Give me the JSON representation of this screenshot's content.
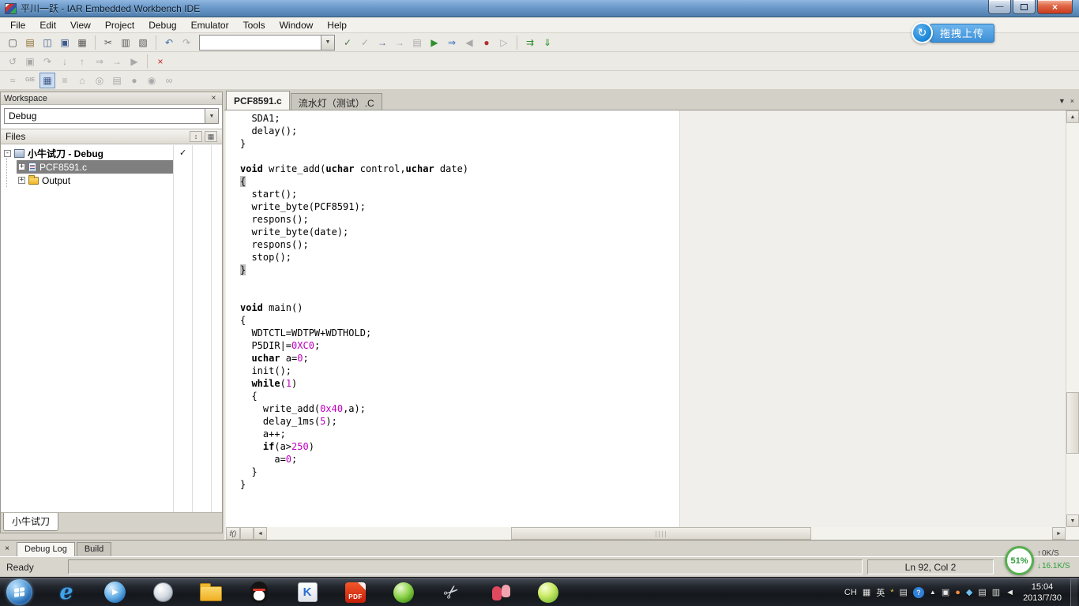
{
  "window": {
    "title": "平川一跃 - IAR Embedded Workbench IDE"
  },
  "overlay": {
    "label": "拖拽上传",
    "icon_glyph": "↻"
  },
  "glyphs": {
    "close": "×",
    "dropdown": "▼",
    "up": "▲",
    "down": "▼",
    "left": "◄",
    "right": "►",
    "fn": "f()",
    "min": "—"
  },
  "menubar": {
    "items": [
      "File",
      "Edit",
      "View",
      "Project",
      "Debug",
      "Emulator",
      "Tools",
      "Window",
      "Help"
    ]
  },
  "toolbar_main": {
    "icons": [
      {
        "type": "icon",
        "name": "new-document-icon",
        "glyph": "▢",
        "color": "#4a4a4a"
      },
      {
        "type": "icon",
        "name": "open-file-icon",
        "glyph": "▤",
        "color": "#8a6d2a"
      },
      {
        "type": "icon",
        "name": "save-icon",
        "glyph": "◫",
        "color": "#3c5a8c"
      },
      {
        "type": "icon",
        "name": "save-all-icon",
        "glyph": "▣",
        "color": "#3c5a8c"
      },
      {
        "type": "icon",
        "name": "print-icon",
        "glyph": "▦",
        "color": "#555555"
      },
      {
        "type": "sep"
      },
      {
        "type": "icon",
        "name": "cut-icon",
        "glyph": "✂",
        "color": "#555555"
      },
      {
        "type": "icon",
        "name": "copy-icon",
        "glyph": "▥",
        "color": "#555555"
      },
      {
        "type": "icon",
        "name": "paste-icon",
        "glyph": "▧",
        "color": "#555555"
      },
      {
        "type": "sep"
      },
      {
        "type": "icon",
        "name": "undo-icon",
        "glyph": "↶",
        "color": "#3a6ea5"
      },
      {
        "type": "icon",
        "name": "redo-icon",
        "glyph": "↷",
        "disabled": true
      },
      {
        "type": "combo",
        "name": "quick-search-combobox"
      },
      {
        "type": "icon",
        "name": "find-icon",
        "glyph": "✓",
        "color": "#4a7a4a"
      },
      {
        "type": "icon",
        "name": "find-next-icon",
        "glyph": "✓",
        "disabled": true
      },
      {
        "type": "icon",
        "name": "goto-icon",
        "glyph": "→",
        "color": "#4a6a9a"
      },
      {
        "type": "icon",
        "name": "browse-icon",
        "glyph": "→",
        "disabled": true
      },
      {
        "type": "icon",
        "name": "bookmark-icon",
        "glyph": "▤",
        "disabled": true
      },
      {
        "type": "icon",
        "name": "compile-icon",
        "glyph": "▶",
        "color": "#2f8f2f"
      },
      {
        "type": "icon",
        "name": "make-icon",
        "glyph": "⇒",
        "color": "#2f6fbf"
      },
      {
        "type": "icon",
        "name": "stop-build-icon",
        "glyph": "◀",
        "disabled": true
      },
      {
        "type": "icon",
        "name": "toggle-breakpoint-icon",
        "glyph": "●",
        "color": "#b03030"
      },
      {
        "type": "icon",
        "name": "debug-without-downloading-icon",
        "glyph": "▷",
        "disabled": true
      },
      {
        "type": "sep"
      },
      {
        "type": "icon",
        "name": "make-project-icon",
        "glyph": "⇉",
        "color": "#2f8f2f"
      },
      {
        "type": "icon",
        "name": "download-and-debug-icon",
        "glyph": "⇓",
        "color": "#2f8f2f"
      }
    ]
  },
  "toolbar_debug": {
    "icons": [
      {
        "type": "icon",
        "name": "reset-icon",
        "glyph": "↺",
        "disabled": true
      },
      {
        "type": "icon",
        "name": "break-icon",
        "glyph": "▣",
        "disabled": true
      },
      {
        "type": "icon",
        "name": "step-over-icon",
        "glyph": "↷",
        "disabled": true
      },
      {
        "type": "icon",
        "name": "step-into-icon",
        "glyph": "↓",
        "disabled": true
      },
      {
        "type": "icon",
        "name": "step-out-icon",
        "glyph": "↑",
        "disabled": true
      },
      {
        "type": "icon",
        "name": "next-statement-icon",
        "glyph": "⇒",
        "disabled": true
      },
      {
        "type": "icon",
        "name": "run-to-cursor-icon",
        "glyph": "→",
        "disabled": true
      },
      {
        "type": "icon",
        "name": "go-icon",
        "glyph": "▶",
        "disabled": true
      },
      {
        "type": "sep"
      },
      {
        "type": "icon",
        "name": "stop-debugging-icon",
        "glyph": "×",
        "color": "#c42222"
      }
    ]
  },
  "toolbar_emulator": {
    "icons": [
      {
        "type": "icon",
        "name": "macro-icon",
        "glyph": "≈",
        "disabled": true
      },
      {
        "type": "icon",
        "name": "gie-icon",
        "glyph": "GIE",
        "small": true,
        "disabled": true
      },
      {
        "type": "icon",
        "name": "register-window-icon",
        "glyph": "▦",
        "pressed": true,
        "color": "#3c5a8c"
      },
      {
        "type": "icon",
        "name": "memory-window-icon",
        "glyph": "≡",
        "disabled": true
      },
      {
        "type": "icon",
        "name": "stack-window-icon",
        "glyph": "⌂",
        "disabled": true
      },
      {
        "type": "icon",
        "name": "breakpoint-usage-icon",
        "glyph": "◎",
        "disabled": true
      },
      {
        "type": "icon",
        "name": "cycle-counter-icon",
        "glyph": "▤",
        "disabled": true
      },
      {
        "type": "icon",
        "name": "led-icon",
        "glyph": "●",
        "disabled": true
      },
      {
        "type": "icon",
        "name": "power-log-icon",
        "glyph": "◉",
        "disabled": true
      },
      {
        "type": "icon",
        "name": "probe-icon",
        "glyph": "∞",
        "disabled": true
      }
    ]
  },
  "workspace": {
    "title": "Workspace",
    "config": "Debug",
    "files_label": "Files",
    "header_icons": [
      {
        "name": "filter-icon",
        "glyph": "↕"
      },
      {
        "name": "columns-icon",
        "glyph": "▦"
      }
    ],
    "project": {
      "expander": "-",
      "label": "小牛试刀 - Debug",
      "check": "✓"
    },
    "file": {
      "expander": "+",
      "label": "PCF8591.c"
    },
    "output": {
      "expander": "+",
      "label": "Output"
    },
    "bottom_tab": "小牛试刀"
  },
  "editor": {
    "tabs": [
      {
        "label": "PCF8591.c",
        "active": true
      },
      {
        "label": "流水灯（测试）.C",
        "active": false
      }
    ],
    "code": [
      [
        [
          "  SDA1;",
          ""
        ]
      ],
      [
        [
          "  delay();",
          ""
        ]
      ],
      [
        [
          "}",
          ""
        ]
      ],
      [],
      [
        [
          "void",
          "kw"
        ],
        [
          " write_add(",
          ""
        ],
        [
          "uchar",
          "kw"
        ],
        [
          " control,",
          ""
        ],
        [
          "uchar",
          "kw"
        ],
        [
          " date)",
          ""
        ]
      ],
      [
        [
          "{",
          "hl"
        ]
      ],
      [
        [
          "  start();",
          ""
        ]
      ],
      [
        [
          "  write_byte(PCF8591);",
          ""
        ]
      ],
      [
        [
          "  respons();",
          ""
        ]
      ],
      [
        [
          "  write_byte(date);",
          ""
        ]
      ],
      [
        [
          "  respons();",
          ""
        ]
      ],
      [
        [
          "  stop();",
          ""
        ]
      ],
      [
        [
          "}",
          "hl"
        ]
      ],
      [],
      [],
      [
        [
          "void",
          "kw"
        ],
        [
          " main()",
          ""
        ]
      ],
      [
        [
          "{",
          ""
        ]
      ],
      [
        [
          "  WDTCTL=WDTPW+WDTHOLD;",
          ""
        ]
      ],
      [
        [
          "  P5DIR|=",
          ""
        ],
        [
          "0XC0",
          "num"
        ],
        [
          ";",
          ""
        ]
      ],
      [
        [
          "  ",
          ""
        ],
        [
          "uchar",
          "kw"
        ],
        [
          " a=",
          ""
        ],
        [
          "0",
          "num"
        ],
        [
          ";",
          ""
        ]
      ],
      [
        [
          "  init();",
          ""
        ]
      ],
      [
        [
          "  ",
          ""
        ],
        [
          "while",
          "kw"
        ],
        [
          "(",
          ""
        ],
        [
          "1",
          "num"
        ],
        [
          ")",
          ""
        ]
      ],
      [
        [
          "  {",
          ""
        ]
      ],
      [
        [
          "    write_add(",
          ""
        ],
        [
          "0x40",
          "num"
        ],
        [
          ",a);",
          ""
        ]
      ],
      [
        [
          "    delay_1ms(",
          ""
        ],
        [
          "5",
          "num"
        ],
        [
          ");",
          ""
        ]
      ],
      [
        [
          "    a++;",
          ""
        ]
      ],
      [
        [
          "    ",
          ""
        ],
        [
          "if",
          "kw"
        ],
        [
          "(a>",
          ""
        ],
        [
          "250",
          "num"
        ],
        [
          ")",
          ""
        ]
      ],
      [
        [
          "      a=",
          ""
        ],
        [
          "0",
          "num"
        ],
        [
          ";",
          ""
        ]
      ],
      [
        [
          "  }",
          ""
        ]
      ],
      [
        [
          "}",
          ""
        ]
      ]
    ]
  },
  "output_tabs": [
    {
      "label": "Debug Log",
      "active": true
    },
    {
      "label": "Build",
      "active": false
    }
  ],
  "statusbar": {
    "ready": "Ready",
    "caret": "Ln 92, Col 2"
  },
  "net_monitor": {
    "percent": "51%",
    "up_arrow": "↑",
    "up": "0K/S",
    "down_arrow": "↓",
    "down": "16.1K/S"
  },
  "taskbar": {
    "apps": [
      {
        "name": "ie-icon",
        "glyph": "e"
      },
      {
        "name": "media-player-icon",
        "glyph": "▶"
      },
      {
        "name": "search-tool-icon",
        "glyph": ""
      },
      {
        "name": "explorer-icon",
        "glyph": ""
      },
      {
        "name": "qq-icon",
        "glyph": ""
      },
      {
        "name": "wps-icon",
        "glyph": "K"
      },
      {
        "name": "pdf-icon",
        "glyph": "PDF"
      },
      {
        "name": "security-ball-icon",
        "glyph": ""
      },
      {
        "name": "scissors-tool-icon",
        "glyph": "✂"
      },
      {
        "name": "contacts-icon",
        "glyph": ""
      },
      {
        "name": "lime-ball-icon",
        "glyph": ""
      }
    ],
    "tray": [
      {
        "name": "lang-indicator",
        "text": "CH"
      },
      {
        "name": "ime-keyboard-icon",
        "glyph": "▦"
      },
      {
        "name": "ime-lang-indicator",
        "text": "英"
      },
      {
        "name": "ime-skin-icon",
        "glyph": "*",
        "color": "#f6c84c"
      },
      {
        "name": "ime-tool-icon",
        "glyph": "▤"
      },
      {
        "name": "help-tray-icon",
        "glyph": "?",
        "cls": "help"
      },
      {
        "name": "hidden-icons-button",
        "glyph": "▲",
        "cls": "dim"
      },
      {
        "name": "network-tray-icon",
        "glyph": "▣"
      },
      {
        "name": "wangwang-tray-icon",
        "glyph": "●",
        "color": "#f08a3c"
      },
      {
        "name": "security-tray-icon",
        "glyph": "◆",
        "color": "#6cc0f0"
      },
      {
        "name": "calendar-tray-icon",
        "glyph": "▤"
      },
      {
        "name": "display-tray-icon",
        "glyph": "▥"
      },
      {
        "name": "volume-tray-icon",
        "glyph": "◄"
      }
    ],
    "clock": {
      "time": "15:04",
      "date": "2013/7/30"
    }
  }
}
